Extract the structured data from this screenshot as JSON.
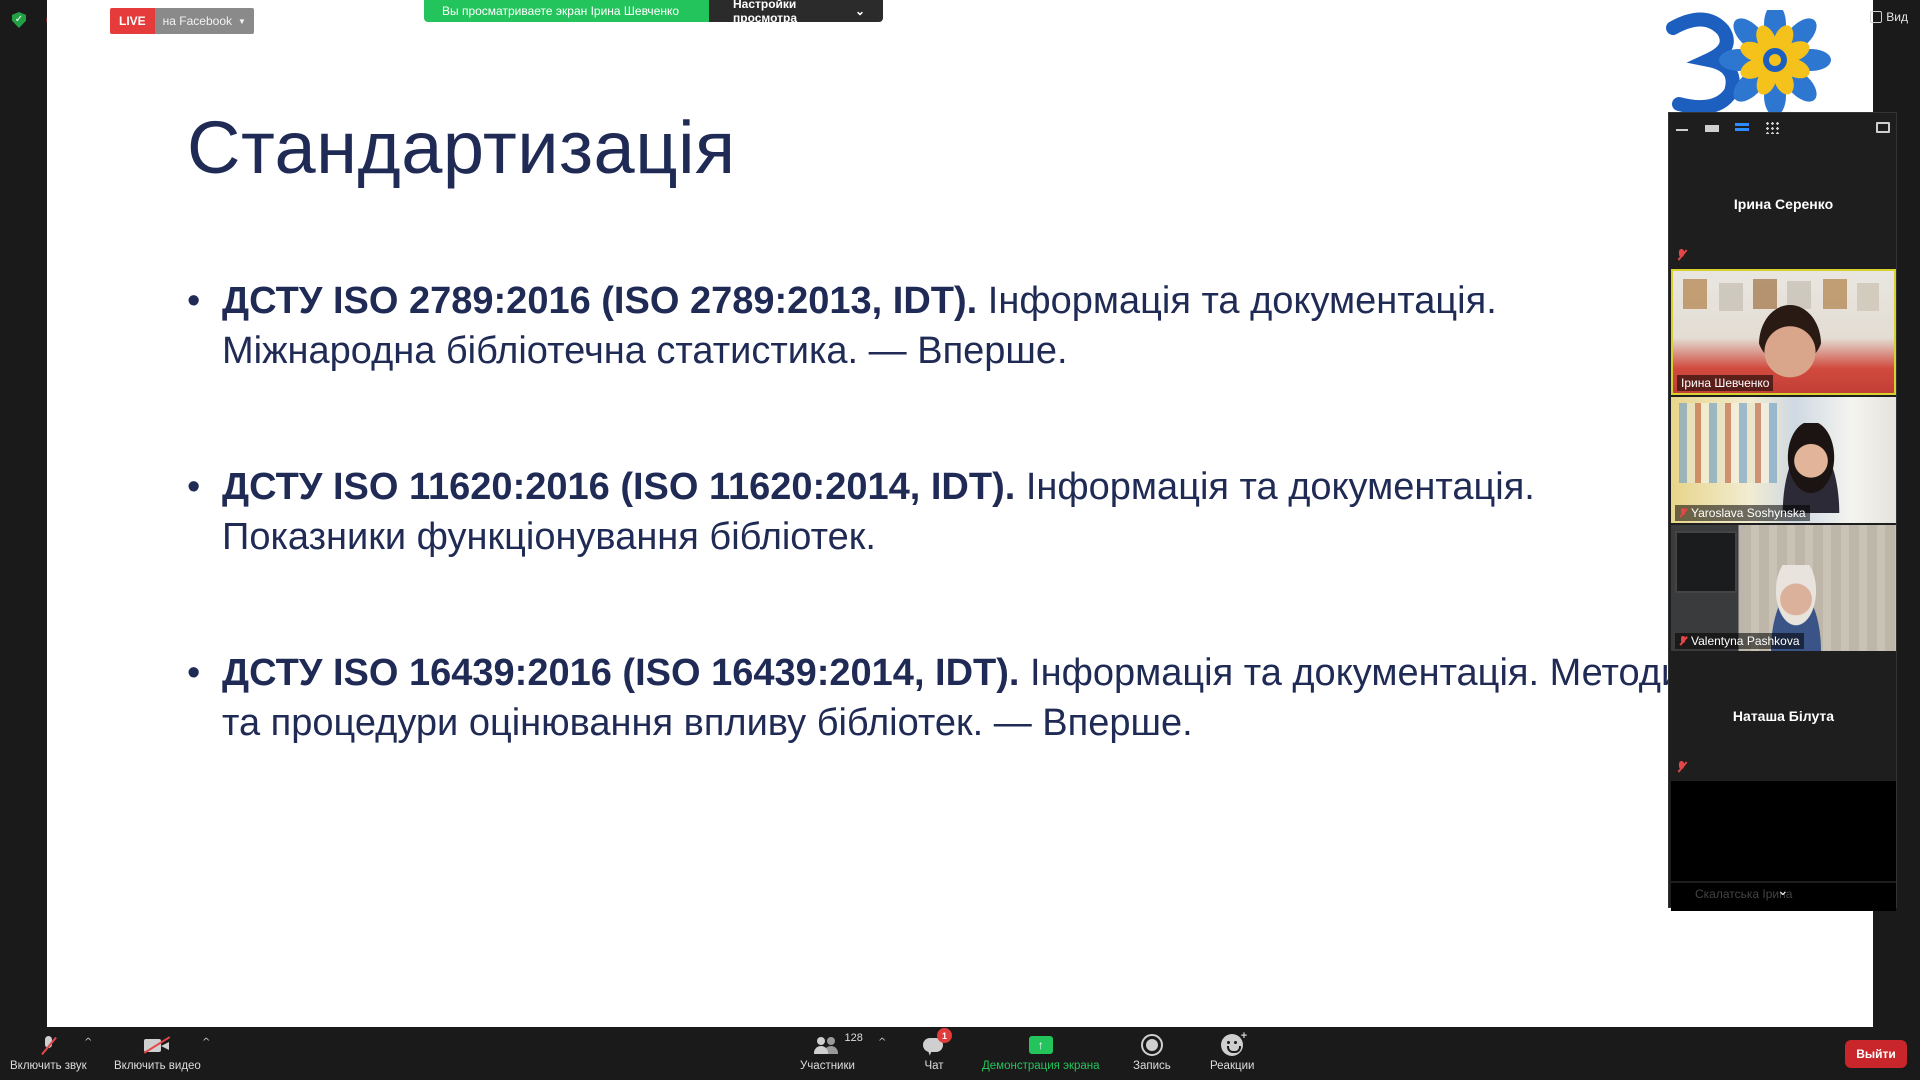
{
  "live": {
    "badge": "LIVE",
    "platform": "на Facebook"
  },
  "share_banner": {
    "viewing": "Вы просматриваете экран Ірина Шевченко",
    "view_options": "Настройки просмотра"
  },
  "view_button": {
    "label": "Вид"
  },
  "slide": {
    "title": "Стандартизація",
    "bullets": [
      {
        "bold": "ДСТУ ISO 2789:2016 (ISO 2789:2013, IDT).",
        "text": " Інформація та документація. Міжнародна бібліотечна статистика. — Вперше."
      },
      {
        "bold": "ДСТУ ISO 11620:2016 (ISO 11620:2014, IDT).",
        "text": " Інформація та документація. Показники функціонування бібліотек."
      },
      {
        "bold": "ДСТУ ISO 16439:2016 (ISO 16439:2014, IDT).",
        "text": " Інформація та документація. Методи та процедури оцінювання впливу бібліотек. — Вперше."
      }
    ]
  },
  "participants": [
    {
      "name": "Ірина Серенко"
    },
    {
      "name": "Ірина Шевченко"
    },
    {
      "name": "Yaroslava Soshynska"
    },
    {
      "name": "Valentyna Pashkova"
    },
    {
      "name": "Наташа Білута"
    },
    {
      "name": "Скалатська Ірина"
    }
  ],
  "toolbar": {
    "audio": "Включить звук",
    "video": "Включить видео",
    "participants": "Участники",
    "participants_count": "128",
    "chat": "Чат",
    "chat_badge": "1",
    "share": "Демонстрация экрана",
    "record": "Запись",
    "reactions": "Реакции",
    "leave": "Выйти"
  },
  "colors": {
    "slide_text": "#1f2a55",
    "share_green": "#24c45c",
    "live_red": "#e63b3b",
    "leave_red": "#c8262b"
  }
}
